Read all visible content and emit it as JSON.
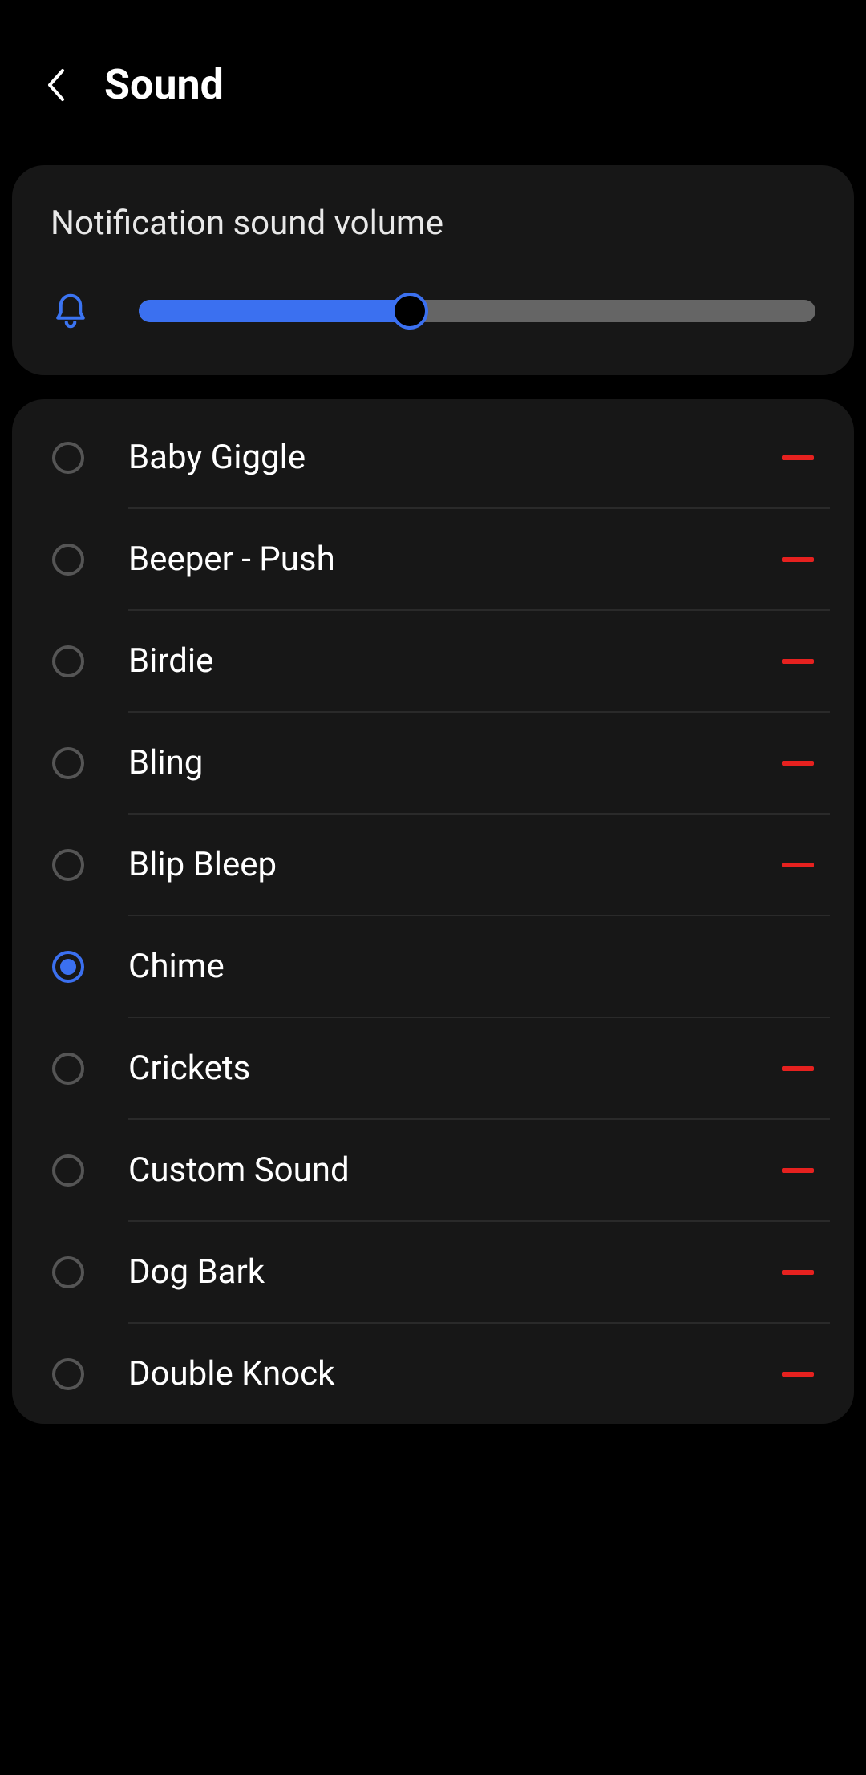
{
  "header": {
    "title": "Sound"
  },
  "volume": {
    "label": "Notification sound volume",
    "percent": 40
  },
  "sounds": [
    {
      "label": "Baby Giggle",
      "selected": false,
      "removable": true
    },
    {
      "label": "Beeper - Push",
      "selected": false,
      "removable": true
    },
    {
      "label": "Birdie",
      "selected": false,
      "removable": true
    },
    {
      "label": "Bling",
      "selected": false,
      "removable": true
    },
    {
      "label": "Blip Bleep",
      "selected": false,
      "removable": true
    },
    {
      "label": "Chime",
      "selected": true,
      "removable": false
    },
    {
      "label": "Crickets",
      "selected": false,
      "removable": true
    },
    {
      "label": "Custom Sound",
      "selected": false,
      "removable": true
    },
    {
      "label": "Dog Bark",
      "selected": false,
      "removable": true
    },
    {
      "label": "Double Knock",
      "selected": false,
      "removable": true
    }
  ],
  "colors": {
    "accent": "#3b70f0",
    "remove": "#e6211f"
  }
}
